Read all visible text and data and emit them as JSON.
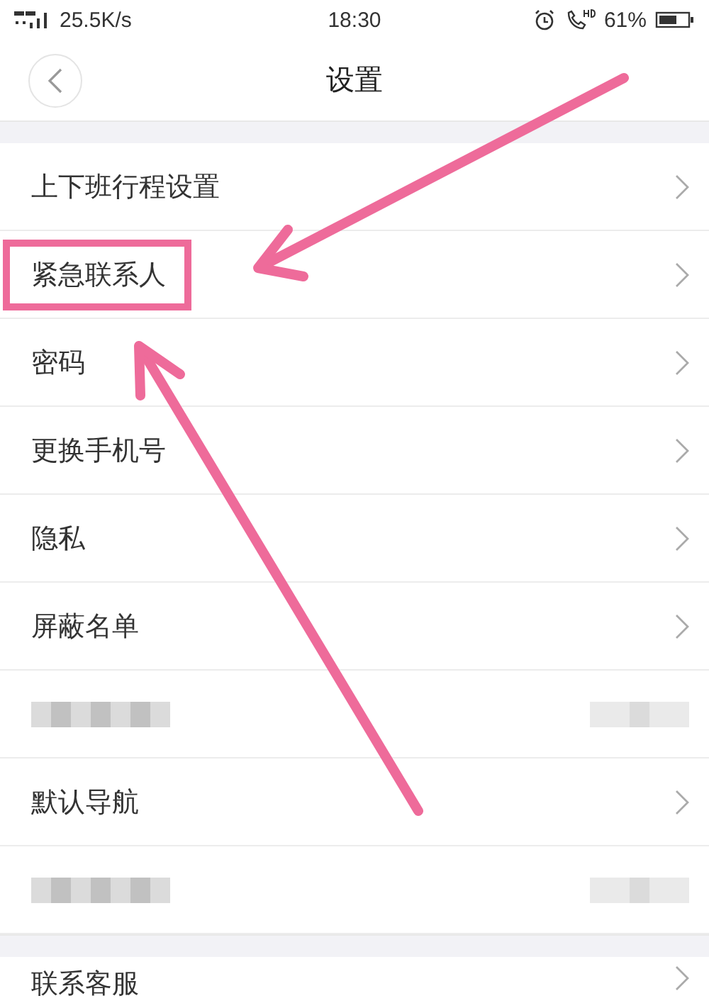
{
  "status_bar": {
    "speed": "25.5K/s",
    "time": "18:30",
    "battery": "61%"
  },
  "nav": {
    "title": "设置"
  },
  "groups": [
    {
      "rows": [
        {
          "kind": "item",
          "label": "上下班行程设置",
          "highlighted": false
        },
        {
          "kind": "item",
          "label": "紧急联系人",
          "highlighted": true
        },
        {
          "kind": "item",
          "label": "密码",
          "highlighted": false
        },
        {
          "kind": "item",
          "label": "更换手机号",
          "highlighted": false
        },
        {
          "kind": "item",
          "label": "隐私",
          "highlighted": false
        },
        {
          "kind": "item",
          "label": "屏蔽名单",
          "highlighted": false
        },
        {
          "kind": "blurred"
        },
        {
          "kind": "item",
          "label": "默认导航",
          "highlighted": false
        },
        {
          "kind": "blurred"
        }
      ]
    },
    {
      "rows": [
        {
          "kind": "item",
          "label": "联系客服",
          "highlighted": false
        }
      ]
    }
  ]
}
